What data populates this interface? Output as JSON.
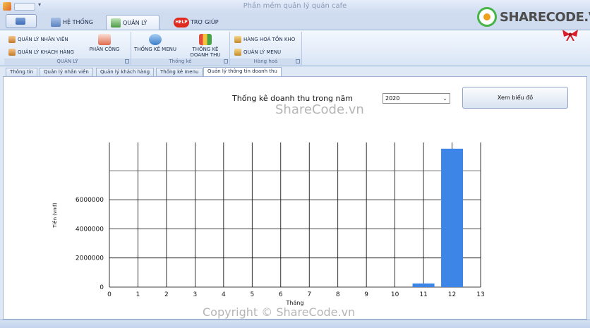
{
  "window": {
    "title": "Phần mềm quản lý quán cafe"
  },
  "ribbon_tabs": [
    {
      "label": "HỆ THỐNG"
    },
    {
      "label": "QUẢN LÝ"
    },
    {
      "label": "TRỢ GIÚP",
      "badge": "HELP"
    }
  ],
  "groups": {
    "quan_ly": {
      "caption": "QUẢN LÝ",
      "buttons": [
        "QUẢN LÝ NHÂN VIÊN",
        "QUẢN LÝ KHÁCH HÀNG",
        "PHÂN CÔNG"
      ]
    },
    "thong_ke": {
      "caption": "Thống kê",
      "buttons": [
        "THỐNG KÊ MENU",
        "THỐNG KÊ",
        "DOANH THU"
      ]
    },
    "hang_hoa": {
      "caption": "Hàng hoá",
      "buttons": [
        "HÀNG HOÁ TỒN KHO",
        "QUẢN LÝ MENU"
      ]
    }
  },
  "doc_tabs": [
    "Thông tin",
    "Quản lý nhân viên",
    "Quản lý khách hàng",
    "Thống kê menu",
    "Quản lý thông tin doanh thu"
  ],
  "stats": {
    "label": "Thống kê doanh thu trong năm",
    "year": "2020",
    "view_button": "Xem biểu đồ"
  },
  "watermarks": [
    "ShareCode.vn",
    "Copyright © ShareCode.vn"
  ],
  "logo": {
    "text": "SHARECODE.VN"
  },
  "colors": {
    "bar": "#3d86e8",
    "accent": "#47b447"
  },
  "chart_data": {
    "type": "bar",
    "x": [
      11,
      12
    ],
    "values": [
      250000,
      9500000
    ],
    "xlim": [
      0,
      13
    ],
    "ylim": [
      0,
      8000000
    ],
    "xticks": [
      "0",
      "1",
      "2",
      "3",
      "4",
      "5",
      "6",
      "7",
      "8",
      "9",
      "10",
      "11",
      "12",
      "13"
    ],
    "yticks": [
      "0",
      "2000000",
      "4000000",
      "6000000"
    ],
    "xlabel": "Tháng",
    "ylabel": "Tiền (vnđ)",
    "grid": true
  }
}
